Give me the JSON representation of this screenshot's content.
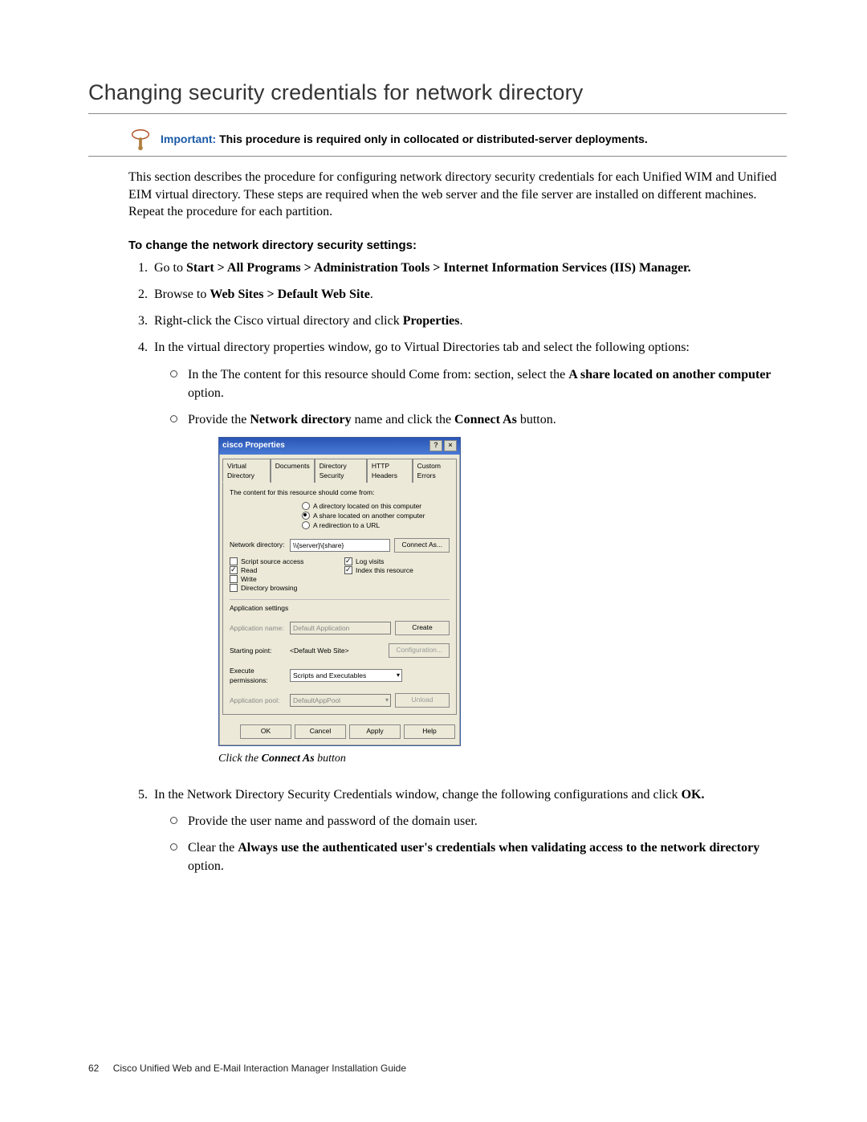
{
  "heading": "Changing security credentials for network directory",
  "callout": {
    "label": "Important:",
    "text": "This procedure is required only in collocated or distributed-server deployments."
  },
  "intro_para": "This section describes the procedure for configuring network directory security credentials for each Unified WIM and Unified EIM virtual directory. These steps are required when the web server and the file server are installed on different machines. Repeat the procedure for each partition.",
  "sub_heading": "To change the network directory security settings:",
  "steps": {
    "s1_a": "Go to ",
    "s1_b": "Start > All Programs > Administration Tools > Internet Information Services (IIS) Manager.",
    "s2_a": "Browse to ",
    "s2_b": "Web Sites > Default Web Site",
    "s2_c": ".",
    "s3_a": "Right-click the Cisco virtual directory and click ",
    "s3_b": "Properties",
    "s3_c": ".",
    "s4": "In the virtual directory properties window, go to Virtual Directories tab and select the following options:",
    "s4_sub1_a": "In the The content for this resource should Come from: section, select the ",
    "s4_sub1_b": "A share located on another computer",
    "s4_sub1_c": " option.",
    "s4_sub2_a": "Provide the ",
    "s4_sub2_b": "Network directory",
    "s4_sub2_c": " name and click the ",
    "s4_sub2_d": "Connect As",
    "s4_sub2_e": " button.",
    "s5_a": "In the Network Directory Security Credentials window, change the following configurations and click ",
    "s5_b": "OK.",
    "s5_sub1": "Provide the user name and password of the domain user.",
    "s5_sub2_a": "Clear the ",
    "s5_sub2_b": "Always use the authenticated user's credentials when validating access to the network directory",
    "s5_sub2_c": " option."
  },
  "caption_a": "Click the ",
  "caption_b": "Connect As",
  "caption_c": " button",
  "footer_page": "62",
  "footer_text": "Cisco Unified Web and E-Mail Interaction Manager Installation Guide",
  "dialog": {
    "title": "cisco Properties",
    "help_btn": "?",
    "close_btn": "×",
    "tabs": {
      "t1": "Virtual Directory",
      "t2": "Documents",
      "t3": "Directory Security",
      "t4": "HTTP Headers",
      "t5": "Custom Errors"
    },
    "content_from": "The content for this resource should come from:",
    "r1": "A directory located on this computer",
    "r2": "A share located on another computer",
    "r3": "A redirection to a URL",
    "netdir_label": "Network directory:",
    "netdir_value": "\\\\{server}\\{share}",
    "connect_as_btn": "Connect As...",
    "chk_script": "Script source access",
    "chk_read": "Read",
    "chk_write": "Write",
    "chk_dir": "Directory browsing",
    "chk_log": "Log visits",
    "chk_index": "Index this resource",
    "app_settings": "Application settings",
    "appname_label": "Application name:",
    "appname_value": "Default Application",
    "create_btn": "Create",
    "starting_label": "Starting point:",
    "starting_value": "<Default Web Site>",
    "config_btn": "Configuration...",
    "exec_label": "Execute permissions:",
    "exec_value": "Scripts and Executables",
    "pool_label": "Application pool:",
    "pool_value": "DefaultAppPool",
    "unload_btn": "Unload",
    "ok": "OK",
    "cancel": "Cancel",
    "apply": "Apply",
    "help": "Help"
  }
}
